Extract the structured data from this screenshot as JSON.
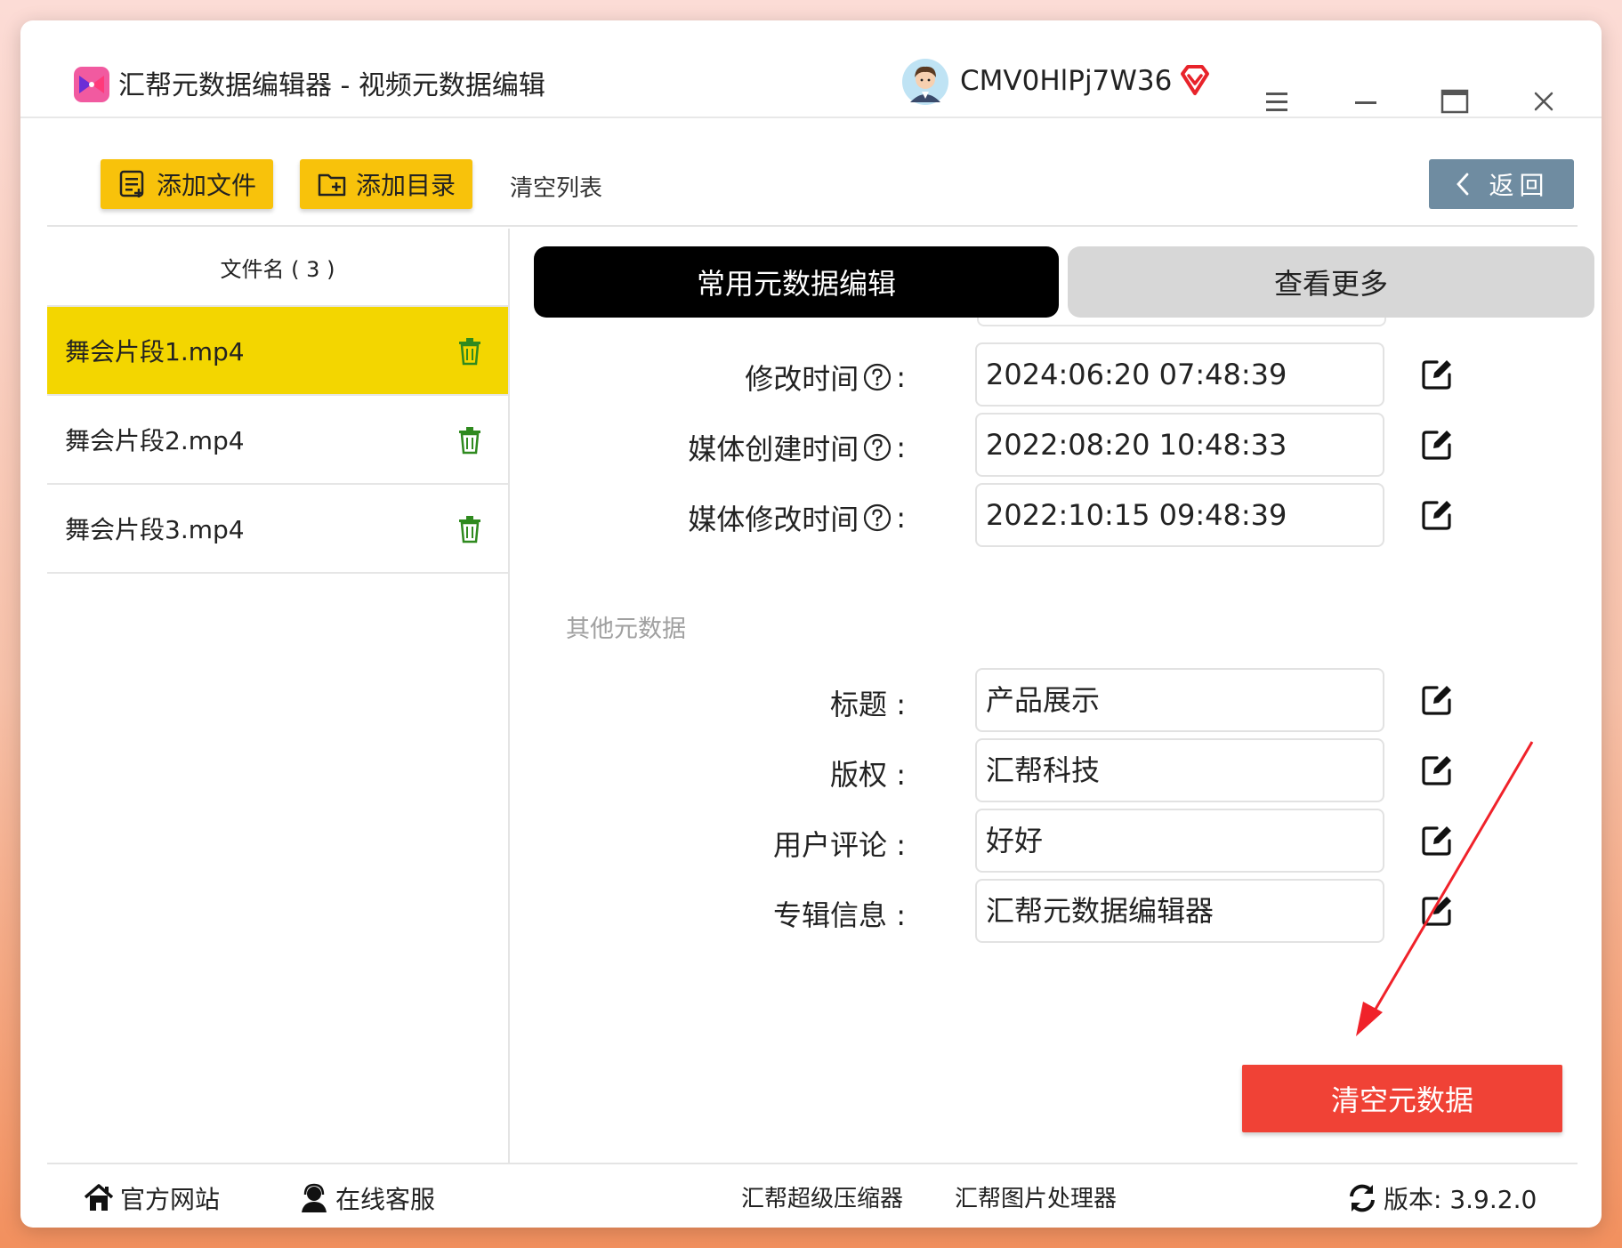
{
  "app": {
    "title": "汇帮元数据编辑器 - 视频元数据编辑",
    "username": "CMV0HlPj7W36"
  },
  "toolbar": {
    "add_file": "添加文件",
    "add_dir": "添加目录",
    "clear_list": "清空列表",
    "back": "返回"
  },
  "sidebar": {
    "header": "文件名 ( 3 )",
    "files": [
      {
        "name": "舞会片段1.mp4"
      },
      {
        "name": "舞会片段2.mp4"
      },
      {
        "name": "舞会片段3.mp4"
      }
    ]
  },
  "tabs": {
    "common": "常用元数据编辑",
    "more": "查看更多"
  },
  "fields": {
    "modified_time": {
      "label": "修改时间",
      "value": "2024:06:20 07:48:39"
    },
    "media_created": {
      "label": "媒体创建时间",
      "value": "2022:08:20 10:48:33"
    },
    "media_modified": {
      "label": "媒体修改时间",
      "value": "2022:10:15 09:48:39"
    },
    "section_other": "其他元数据",
    "title": {
      "label": "标题 :",
      "value": "产品展示"
    },
    "copyright": {
      "label": "版权 :",
      "value": "汇帮科技"
    },
    "comment": {
      "label": "用户评论 :",
      "value": "好好"
    },
    "album": {
      "label": "专辑信息 :",
      "value": "汇帮元数据编辑器"
    }
  },
  "actions": {
    "clear_metadata": "清空元数据"
  },
  "footer": {
    "site": "官方网站",
    "service": "在线客服",
    "compressor": "汇帮超级压缩器",
    "image_tool": "汇帮图片处理器",
    "version": "版本:  3.9.2.0"
  },
  "colors": {
    "accent_yellow": "#f8c20b",
    "selected_row": "#f3d600",
    "danger": "#f04236",
    "back_button": "#6f8ca1",
    "trash_green": "#2f8a1f"
  }
}
